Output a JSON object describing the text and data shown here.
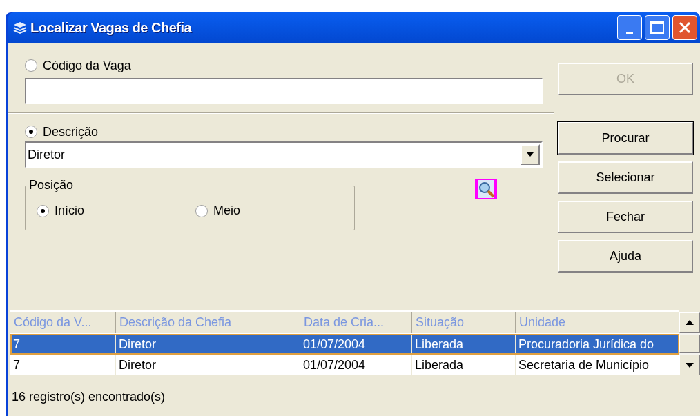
{
  "window": {
    "title": "Localizar Vagas de Chefia"
  },
  "codigo": {
    "label": "Código da Vaga",
    "selected": false
  },
  "descricao": {
    "label": "Descrição",
    "selected": true,
    "value": "Diretor"
  },
  "posicao": {
    "legend": "Posição",
    "options": [
      {
        "label": "Início",
        "selected": true
      },
      {
        "label": "Meio",
        "selected": false
      }
    ]
  },
  "buttons": [
    {
      "label": "OK",
      "disabled": true,
      "default": false
    },
    {
      "label": "Procurar",
      "disabled": false,
      "default": true
    },
    {
      "label": "Selecionar",
      "disabled": false,
      "default": false
    },
    {
      "label": "Fechar",
      "disabled": false,
      "default": false
    },
    {
      "label": "Ajuda",
      "disabled": false,
      "default": false
    }
  ],
  "table": {
    "columns": [
      "Código da V...",
      "Descrição da Chefia",
      "Data de Cria...",
      "Situação",
      "Unidade"
    ],
    "rows": [
      {
        "selected": true,
        "cells": [
          "7",
          "Diretor",
          "01/07/2004",
          "Liberada",
          "Procuradoria Jurídica do"
        ]
      },
      {
        "selected": false,
        "cells": [
          "7",
          "Diretor",
          "01/07/2004",
          "Liberada",
          "Secretaria de Município"
        ]
      }
    ]
  },
  "status_bar": "16 registro(s) encontrado(s)"
}
